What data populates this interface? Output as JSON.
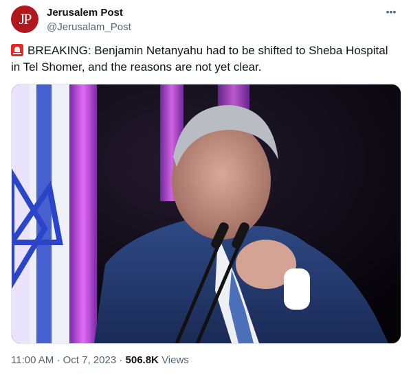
{
  "account": {
    "avatar_text": "JP",
    "display_name": "Jerusalem Post",
    "handle": "@Jerusalam_Post"
  },
  "tweet": {
    "emoji": "siren-icon",
    "text_line1": "BREAKING: Benjamin Netanyahu had to be shifted to Sheba Hospital",
    "text_line2": "in Tel Shomer, and the reasons are not yet clear."
  },
  "meta": {
    "time": "11:00 AM",
    "sep1": "·",
    "date": "Oct 7, 2023",
    "sep2": "·",
    "views_count": "506.8K",
    "views_label": "Views"
  },
  "colors": {
    "avatar_bg": "#b3171e",
    "muted_text": "#536471",
    "flag_blue": "#1f3fbf",
    "stage_purple": "#c040e8"
  }
}
